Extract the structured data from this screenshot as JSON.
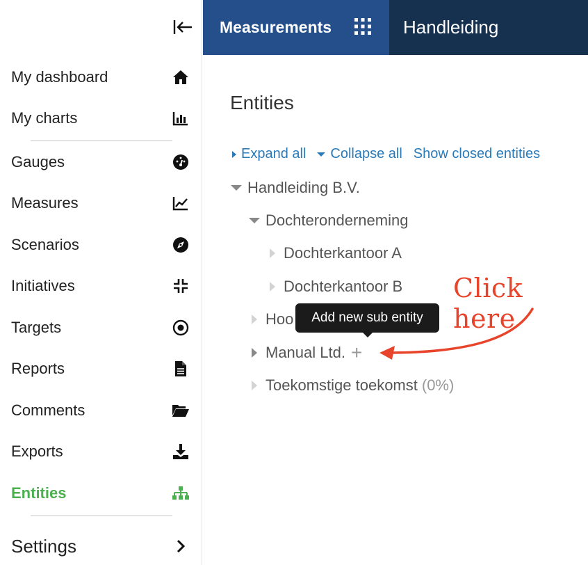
{
  "sidebar": {
    "items": [
      {
        "label": "My dashboard",
        "icon": "home-icon"
      },
      {
        "label": "My charts",
        "icon": "bar-chart-icon"
      },
      {
        "label": "Gauges",
        "icon": "gauge-icon"
      },
      {
        "label": "Measures",
        "icon": "line-chart-icon"
      },
      {
        "label": "Scenarios",
        "icon": "compass-icon"
      },
      {
        "label": "Initiatives",
        "icon": "compress-icon"
      },
      {
        "label": "Targets",
        "icon": "target-icon"
      },
      {
        "label": "Reports",
        "icon": "file-icon"
      },
      {
        "label": "Comments",
        "icon": "folder-open-icon"
      },
      {
        "label": "Exports",
        "icon": "download-icon"
      },
      {
        "label": "Entities",
        "icon": "sitemap-icon",
        "active": true
      }
    ],
    "settings_label": "Settings"
  },
  "header": {
    "app_title": "Measurements",
    "section_title": "Handleiding"
  },
  "main": {
    "title": "Entities",
    "toolbar": {
      "expand_all": "Expand all",
      "collapse_all": "Collapse all",
      "show_closed": "Show closed entities"
    },
    "tree": [
      {
        "label": "Handleiding B.V.",
        "level": 0,
        "state": "expanded"
      },
      {
        "label": "Dochteronderneming",
        "level": 1,
        "state": "expanded"
      },
      {
        "label": "Dochterkantoor A",
        "level": 2,
        "state": "leaf"
      },
      {
        "label": "Dochterkantoor B",
        "level": 2,
        "state": "leaf"
      },
      {
        "label": "Hoo",
        "level": 1,
        "state": "leaf"
      },
      {
        "label": "Manual Ltd.",
        "level": 1,
        "state": "collapsed"
      },
      {
        "label": "Toekomstige toekomst",
        "level": 1,
        "state": "leaf",
        "percent": "(0%)"
      }
    ],
    "tooltip": "Add new sub entity"
  },
  "annotation": {
    "text": "Click here",
    "color": "#e8442b"
  },
  "colors": {
    "header_left": "#244f8a",
    "header_right": "#16304f",
    "link": "#2a7ab8",
    "active": "#4caf50"
  }
}
